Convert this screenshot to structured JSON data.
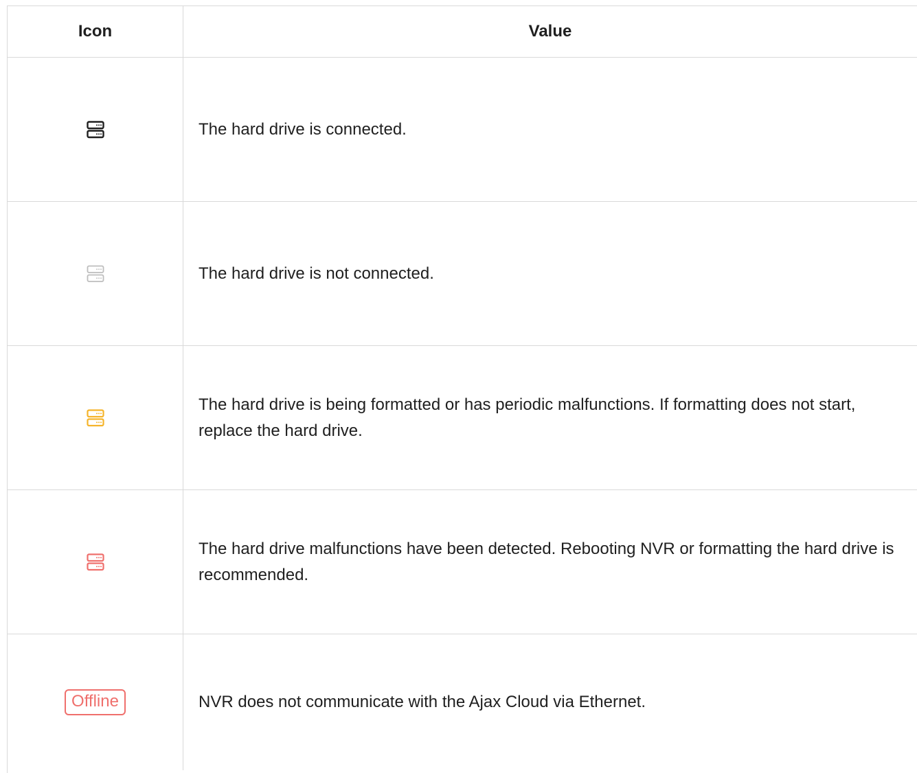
{
  "table": {
    "headers": {
      "icon": "Icon",
      "value": "Value"
    },
    "rows": [
      {
        "icon": "hard-drive-icon",
        "icon_color": "#1f1f1f",
        "value": "The hard drive is connected."
      },
      {
        "icon": "hard-drive-icon",
        "icon_color": "#bdbdbd",
        "value": "The hard drive is not connected."
      },
      {
        "icon": "hard-drive-icon",
        "icon_color": "#f5b42a",
        "value": "The hard drive is being formatted or has periodic malfunctions. If formatting does not start, replace the hard drive."
      },
      {
        "icon": "hard-drive-icon",
        "icon_color": "#ef6f6c",
        "value": "The hard drive malfunctions have been detected. Rebooting NVR or formatting the hard drive is recommended."
      },
      {
        "icon": "offline-badge",
        "badge_label": "Offline",
        "icon_color": "#ef6f6c",
        "value": "NVR does not communicate with the Ajax Cloud via Ethernet."
      }
    ]
  }
}
